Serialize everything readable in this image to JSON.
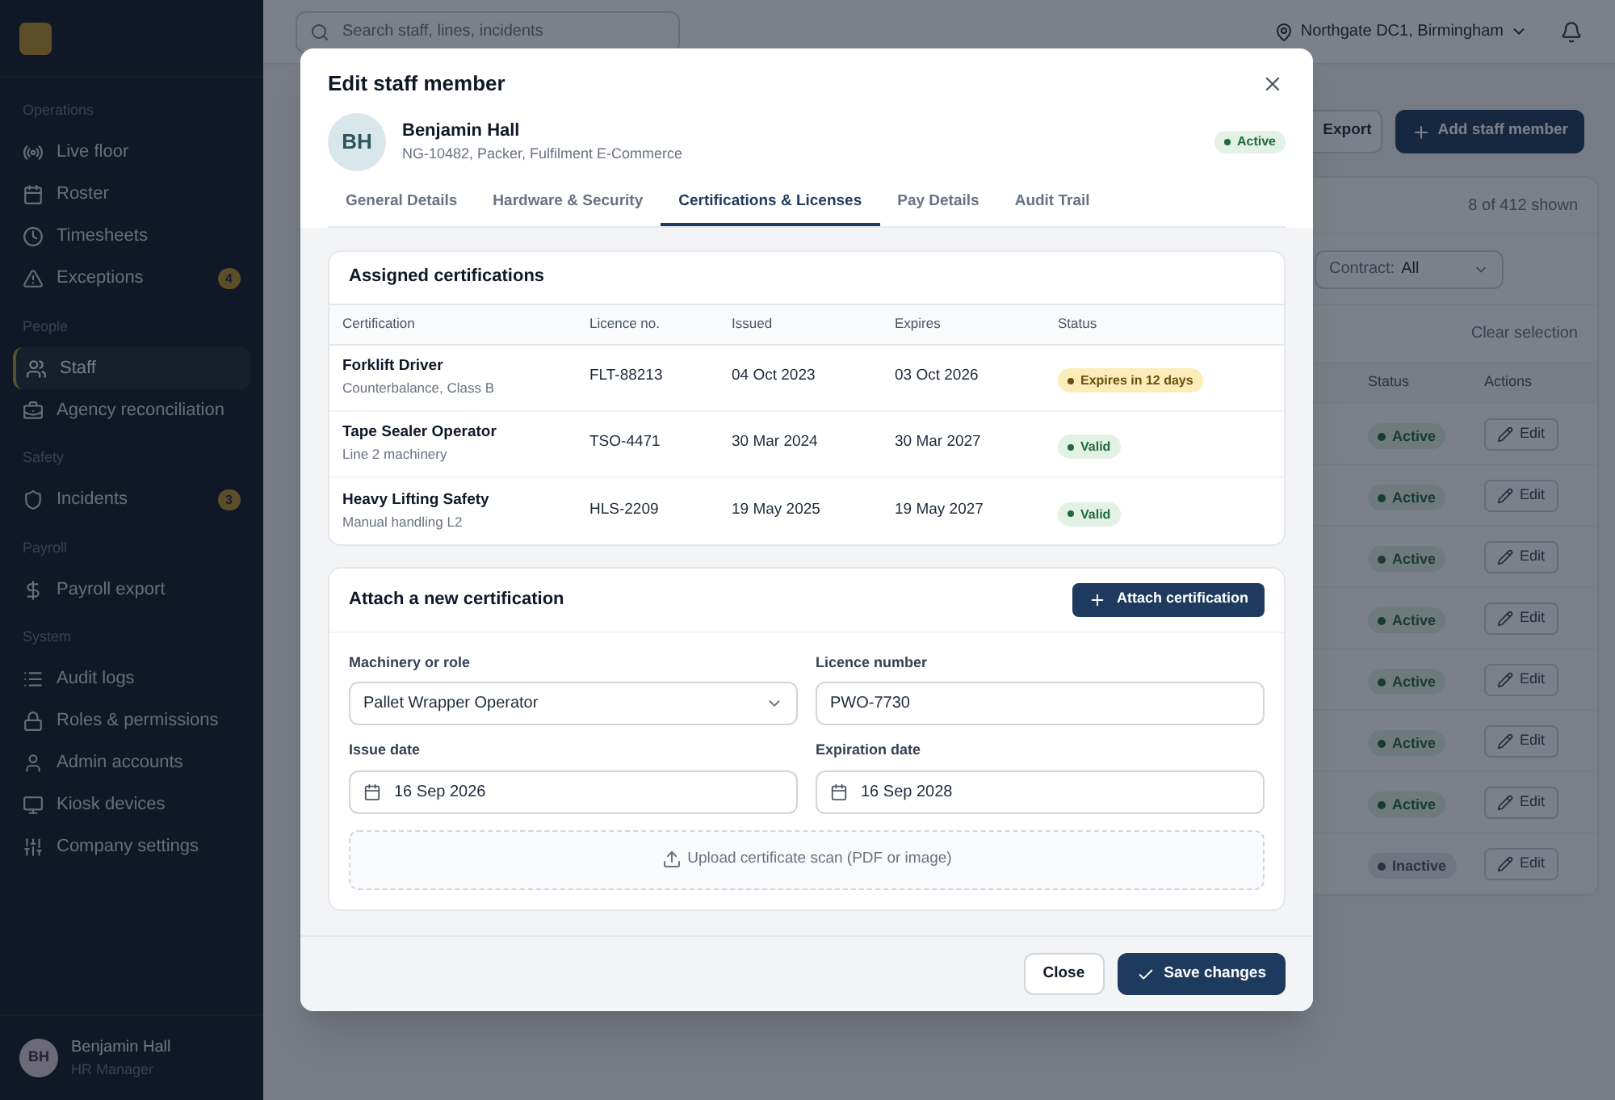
{
  "sidebar": {
    "sections": [
      {
        "title": "Operations",
        "items": [
          {
            "label": "Live floor",
            "selected": false
          },
          {
            "label": "Roster",
            "selected": false
          },
          {
            "label": "Timesheets",
            "selected": false
          },
          {
            "label": "Exceptions",
            "selected": false,
            "badge": "4"
          }
        ]
      },
      {
        "title": "People",
        "items": [
          {
            "label": "Staff",
            "selected": true
          },
          {
            "label": "Agency reconciliation",
            "selected": false
          }
        ]
      },
      {
        "title": "Safety",
        "items": [
          {
            "label": "Incidents",
            "selected": false,
            "badge": "3"
          }
        ]
      },
      {
        "title": "Payroll",
        "items": [
          {
            "label": "Payroll export",
            "selected": false
          }
        ]
      },
      {
        "title": "System",
        "items": [
          {
            "label": "Audit logs",
            "selected": false
          },
          {
            "label": "Roles & permissions",
            "selected": false
          },
          {
            "label": "Admin accounts",
            "selected": false
          },
          {
            "label": "Kiosk devices",
            "selected": false
          },
          {
            "label": "Company settings",
            "selected": false
          }
        ]
      }
    ],
    "user": {
      "initials": "BH",
      "name": "Benjamin Hall",
      "role": "HR Manager"
    }
  },
  "header": {
    "search": {
      "placeholder": "Search staff, lines, incidents"
    },
    "location": "Northgate DC1, Birmingham"
  },
  "page": {
    "buttons": [
      {
        "label": "Export",
        "kind": "secondary"
      },
      {
        "label": "Add staff member",
        "kind": "primary"
      }
    ],
    "count": "8 of 412 shown",
    "filter": {
      "label": "Contract:",
      "value": "All"
    },
    "clear": "Clear selection",
    "columns": [
      "Status",
      "Actions"
    ],
    "rows": [
      {
        "status": "Active",
        "kind": "active",
        "action": "Edit"
      },
      {
        "status": "Active",
        "kind": "active",
        "action": "Edit"
      },
      {
        "status": "Active",
        "kind": "active",
        "action": "Edit"
      },
      {
        "status": "Active",
        "kind": "active",
        "action": "Edit"
      },
      {
        "status": "Active",
        "kind": "active",
        "action": "Edit"
      },
      {
        "status": "Active",
        "kind": "active",
        "action": "Edit"
      },
      {
        "status": "Active",
        "kind": "active",
        "action": "Edit"
      },
      {
        "status": "Inactive",
        "kind": "inactive",
        "action": "Edit"
      }
    ]
  },
  "modal": {
    "title": "Edit staff member",
    "person": {
      "initials": "BH",
      "name": "Benjamin Hall",
      "details": "NG-10482, Packer, Fulfilment E-Commerce",
      "status": "Active"
    },
    "tabs": [
      {
        "label": "General Details",
        "selected": false
      },
      {
        "label": "Hardware & Security",
        "selected": false
      },
      {
        "label": "Certifications & Licenses",
        "selected": true
      },
      {
        "label": "Pay Details",
        "selected": false
      },
      {
        "label": "Audit Trail",
        "selected": false
      }
    ],
    "assigned": {
      "title": "Assigned certifications",
      "columns": [
        "Certification",
        "Licence no.",
        "Issued",
        "Expires",
        "Status"
      ],
      "rows": [
        {
          "name": "Forklift Driver",
          "note": "Counterbalance, Class B",
          "licence": "FLT-88213",
          "issued": "04 Oct 2023",
          "expires": "03 Oct 2026",
          "status": "Expires in 12 days",
          "kind": "warning"
        },
        {
          "name": "Tape Sealer Operator",
          "note": "Line 2 machinery",
          "licence": "TSO-4471",
          "issued": "30 Mar 2024",
          "expires": "30 Mar 2027",
          "status": "Valid",
          "kind": "valid"
        },
        {
          "name": "Heavy Lifting Safety",
          "note": "Manual handling L2",
          "licence": "HLS-2209",
          "issued": "19 May 2025",
          "expires": "19 May 2027",
          "status": "Valid",
          "kind": "valid"
        }
      ]
    },
    "attach": {
      "title": "Attach a new certification",
      "button": "Attach certification",
      "fields": [
        {
          "label": "Machinery or role",
          "value": "Pallet Wrapper Operator",
          "kind": "select"
        },
        {
          "label": "Licence number",
          "value": "PWO-7730",
          "kind": "text"
        },
        {
          "label": "Issue date",
          "value": "16 Sep 2026",
          "kind": "date"
        },
        {
          "label": "Expiration date",
          "value": "16 Sep 2028",
          "kind": "date"
        }
      ],
      "upload": "Upload certificate scan (PDF or image)"
    },
    "footer": {
      "buttons": [
        {
          "label": "Close",
          "kind": "secondary"
        },
        {
          "label": "Save changes",
          "kind": "primary"
        }
      ]
    }
  }
}
